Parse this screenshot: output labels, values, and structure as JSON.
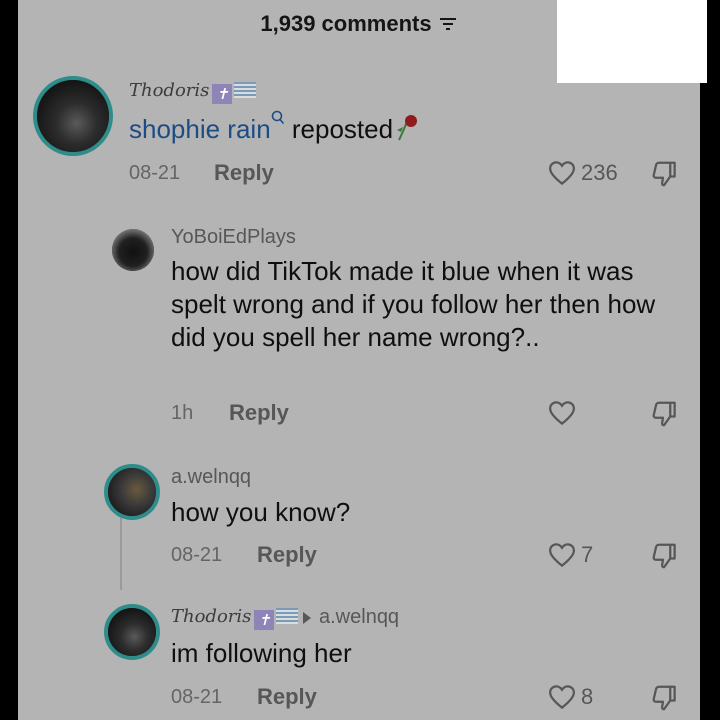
{
  "header": {
    "comments_count": "1,939 comments"
  },
  "comments": [
    {
      "username": "Thodoris",
      "body_link": "shophie rain",
      "body_rest": " reposted",
      "date": "08-21",
      "reply_label": "Reply",
      "likes": "236"
    },
    {
      "username": "YoBoiEdPlays",
      "body": "how did TikTok made it blue when it was spelt wrong and if you follow her then how did you spell her name wrong?..",
      "date": "1h",
      "reply_label": "Reply",
      "likes": ""
    },
    {
      "username": "a.welnqq",
      "body": "how you know?",
      "date": "08-21",
      "reply_label": "Reply",
      "likes": "7"
    },
    {
      "username": "Thodoris",
      "reply_to": "a.welnqq",
      "body": "im following her",
      "date": "08-21",
      "reply_label": "Reply",
      "likes": "8"
    }
  ],
  "colors": {
    "panel": "#b4b4b4",
    "link": "#1d4c84",
    "ring": "#2e8d8a"
  }
}
